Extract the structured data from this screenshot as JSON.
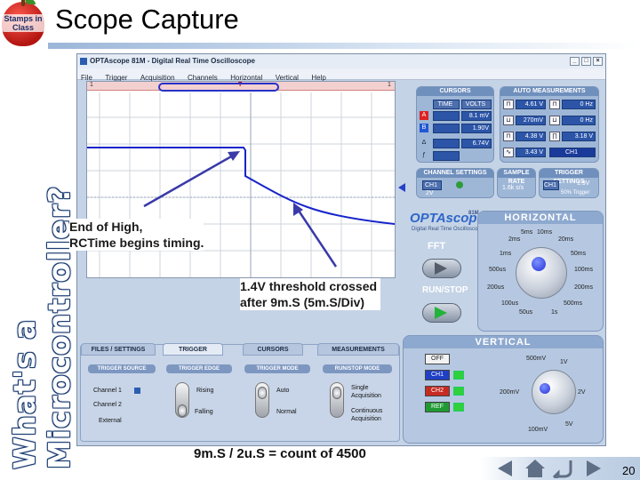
{
  "slide": {
    "title": "Scope Capture",
    "side_text": "What's a Microcontroller?",
    "logo_text": "Stamps in Class",
    "slide_number": "20",
    "caption": "9m.S / 2u.S = count of 4500",
    "annotation_1_line1": "End of High,",
    "annotation_1_line2": "RCTime begins timing.",
    "annotation_2_line1": "1.4V threshold crossed",
    "annotation_2_line2": "after 9m.S (5m.S/Div)"
  },
  "window": {
    "title": "OPTAscope 81M - Digital Real Time Oscilloscope",
    "btn_min": "_",
    "btn_max": "□",
    "btn_close": "×",
    "menu": [
      "File",
      "Trigger",
      "Acquisition",
      "Channels",
      "Horizontal",
      "Vertical",
      "Help"
    ]
  },
  "trigger_bar": {
    "left": "1",
    "right": "1",
    "marker": "T"
  },
  "cursors": {
    "header": "CURSORS",
    "col_time": "TIME",
    "col_volts": "VOLTS",
    "row_a_volts": "8.1 mV",
    "row_b_volts": "1.90V",
    "delta_volts": "6.74V",
    "marker_a": "A",
    "marker_b": "B",
    "marker_delta": "Δ",
    "marker_f": "ƒ"
  },
  "auto_measurements": {
    "header": "AUTO MEASUREMENTS",
    "values": [
      "4.61 V",
      "0 Hz",
      "270mV",
      "0 Hz",
      "4.38 V",
      "3.18 V",
      "3.43 V",
      "CH1"
    ]
  },
  "channel_settings": {
    "header": "CHANNEL SETTINGS",
    "ch": "CH1",
    "scale": "2V"
  },
  "sample_rate": {
    "header": "SAMPLE RATE",
    "value": "1.6k s/s"
  },
  "trigger_settings": {
    "header": "TRIGGER SETTINGS",
    "ch": "CH1",
    "level": "1.9V",
    "pos": "50% Trigger"
  },
  "brand": {
    "name": "OPTAscope",
    "model": "81M",
    "sub": "Digital Real Time Oscilloscope"
  },
  "fft": {
    "label": "FFT"
  },
  "run_stop": {
    "label": "RUN/STOP"
  },
  "horizontal": {
    "header": "HORIZONTAL",
    "ticks": [
      "5ms",
      "10ms",
      "20ms",
      "2ms",
      "50ms",
      "1ms",
      "100ms",
      "500us",
      "200ms",
      "200us",
      "100us",
      "500ms",
      "50us",
      "1s"
    ]
  },
  "vertical": {
    "header": "VERTICAL",
    "ticks": [
      "500mV",
      "1V",
      "200mV",
      "2V",
      "100mV",
      "5V"
    ],
    "channels": [
      "OFF",
      "CH1",
      "CH2",
      "REF"
    ]
  },
  "tabs": {
    "items": [
      "FILES / SETTINGS",
      "TRIGGER",
      "CURSORS",
      "MEASUREMENTS"
    ],
    "trigger_source": "TRIGGER SOURCE",
    "trigger_edge": "TRIGGER EDGE",
    "trigger_mode": "TRIGGER MODE",
    "run_stop_mode": "RUN/STOP MODE",
    "source_opts": [
      "Channel 1",
      "Channel 2",
      "External"
    ],
    "edge_opts": [
      "Rising",
      "Falling"
    ],
    "mode_opts": [
      "Auto",
      "Normal"
    ],
    "run_opts": [
      "Single Acquisition",
      "Continuous Acquisition"
    ]
  },
  "colors": {
    "trace": "#1624c9",
    "accent": "#2f66c8",
    "panel": "#9fb7d7",
    "arrow": "#3a3aa8"
  }
}
